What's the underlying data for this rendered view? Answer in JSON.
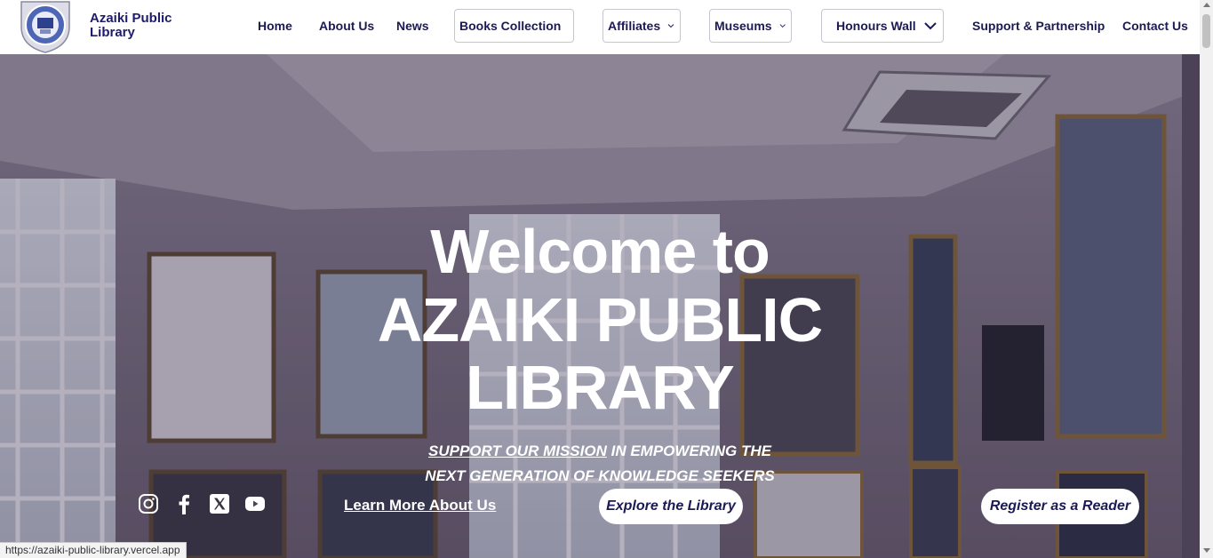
{
  "brand": {
    "name": "Azaiki Public Library"
  },
  "nav": {
    "home": "Home",
    "about": "About Us",
    "news": "News",
    "books": "Books Collection",
    "affiliates": "Affiliates",
    "museums": "Museums",
    "honours": "Honours Wall",
    "support": "Support & Partnership",
    "contact": "Contact Us"
  },
  "hero": {
    "line1": "Welcome to",
    "line2": "AZAIKI PUBLIC",
    "line3": "LIBRARY",
    "mission_link": "SUPPORT OUR MISSION",
    "mission_rest": "IN EMPOWERING THE",
    "mission_line2": "NEXT GENERATION OF KNOWLEDGE SEEKERS",
    "learn_more": "Learn More About Us",
    "explore": "Explore the Library",
    "register": "Register as a Reader"
  },
  "socials": [
    "instagram-icon",
    "facebook-icon",
    "x-icon",
    "youtube-icon"
  ],
  "status_url": "https://azaiki-public-library.vercel.app",
  "colors": {
    "navy": "#1b1a55",
    "white": "#ffffff"
  }
}
